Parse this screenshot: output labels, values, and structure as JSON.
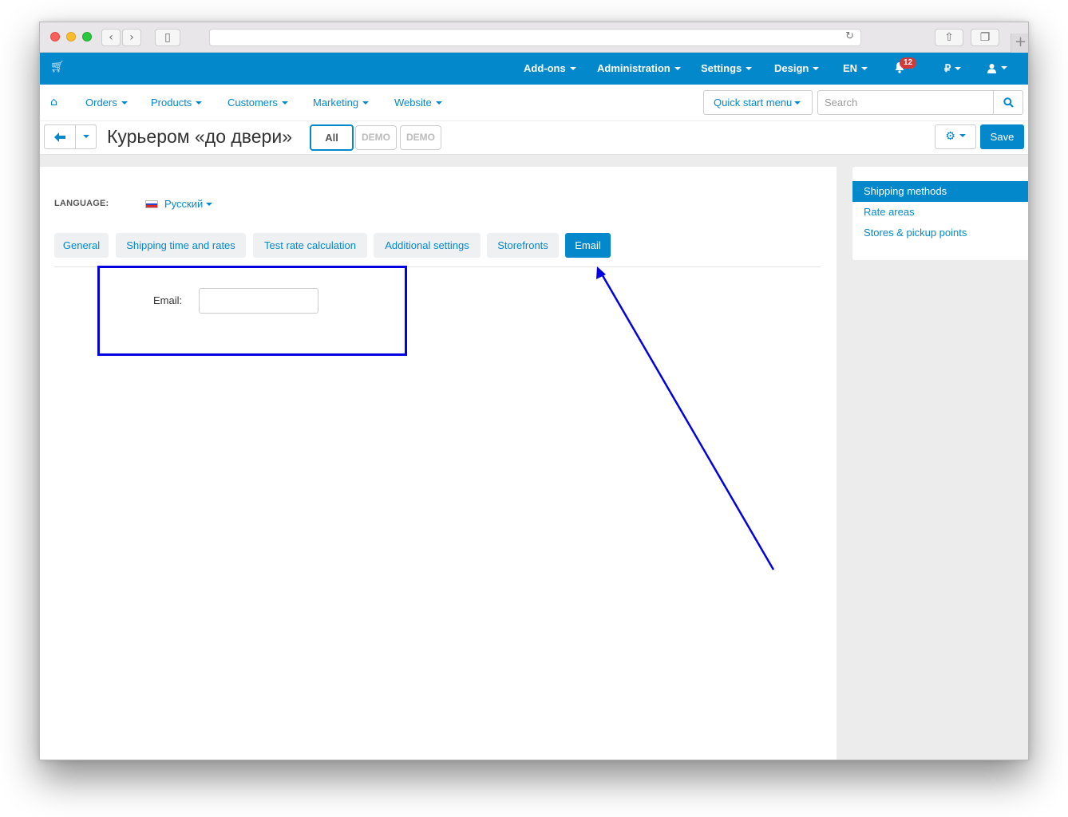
{
  "topbar": {
    "cart_icon": "shopping-cart-icon",
    "addons": "Add-ons",
    "administration": "Administration",
    "settings": "Settings",
    "design": "Design",
    "language": "EN",
    "notifications_count": "12",
    "currency": "₽"
  },
  "subnav": {
    "orders": "Orders",
    "products": "Products",
    "customers": "Customers",
    "marketing": "Marketing",
    "website": "Website",
    "quick_start": "Quick start menu",
    "search_placeholder": "Search"
  },
  "titlebar": {
    "title": "Курьером «до двери»",
    "storefront_all": "All",
    "storefront_1": "DEMO",
    "storefront_2": "DEMO",
    "save": "Save"
  },
  "main": {
    "language_label": "LANGUAGE:",
    "language_value": "Русский",
    "tabs": [
      "General",
      "Shipping time and rates",
      "Test rate calculation",
      "Additional settings",
      "Storefronts",
      "Email"
    ],
    "active_tab": "Email",
    "email_label": "Email:",
    "email_value": ""
  },
  "sidebar": {
    "items": [
      "Shipping methods",
      "Rate areas",
      "Stores & pickup points"
    ],
    "active": "Shipping methods"
  },
  "colors": {
    "accent": "#0388cc",
    "annotation": "#0000e0",
    "badge": "#d23a3a"
  }
}
